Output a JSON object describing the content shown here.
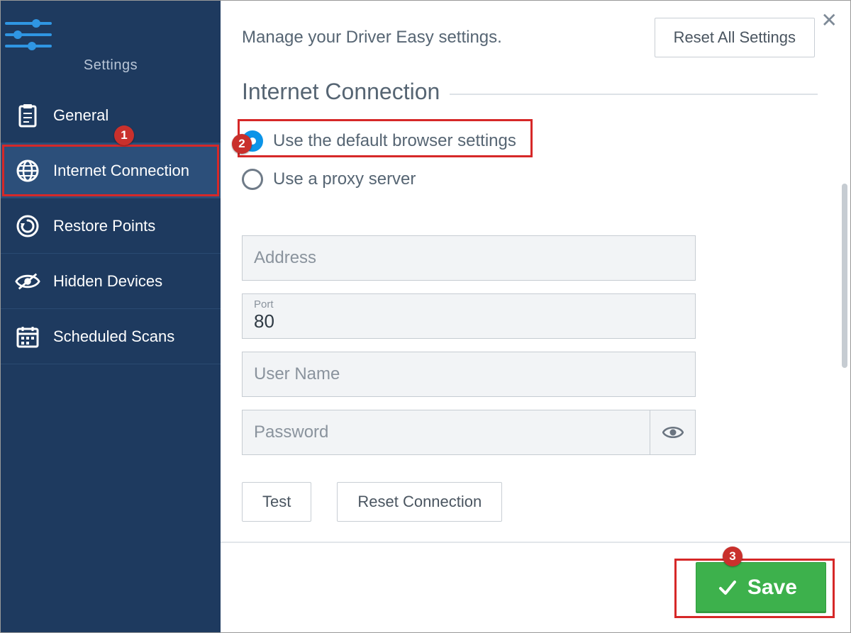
{
  "sidebar": {
    "title": "Settings",
    "items": [
      {
        "label": "General",
        "icon": "clipboard-icon"
      },
      {
        "label": "Internet Connection",
        "icon": "globe-icon"
      },
      {
        "label": "Restore Points",
        "icon": "restore-icon"
      },
      {
        "label": "Hidden Devices",
        "icon": "eye-off-icon"
      },
      {
        "label": "Scheduled Scans",
        "icon": "calendar-icon"
      }
    ],
    "active_index": 1
  },
  "header": {
    "subtitle": "Manage your Driver Easy settings.",
    "reset_label": "Reset All Settings"
  },
  "section": {
    "title": "Internet Connection",
    "radios": {
      "default_browser": "Use the default browser settings",
      "proxy_server": "Use a proxy server",
      "selected": "default_browser"
    },
    "fields": {
      "address": {
        "placeholder": "Address",
        "value": ""
      },
      "port": {
        "label": "Port",
        "value": "80"
      },
      "username": {
        "placeholder": "User Name",
        "value": ""
      },
      "password": {
        "placeholder": "Password",
        "value": ""
      }
    },
    "buttons": {
      "test": "Test",
      "reset": "Reset Connection"
    }
  },
  "footer": {
    "save_label": "Save"
  },
  "annotations": {
    "1": "1",
    "2": "2",
    "3": "3"
  }
}
